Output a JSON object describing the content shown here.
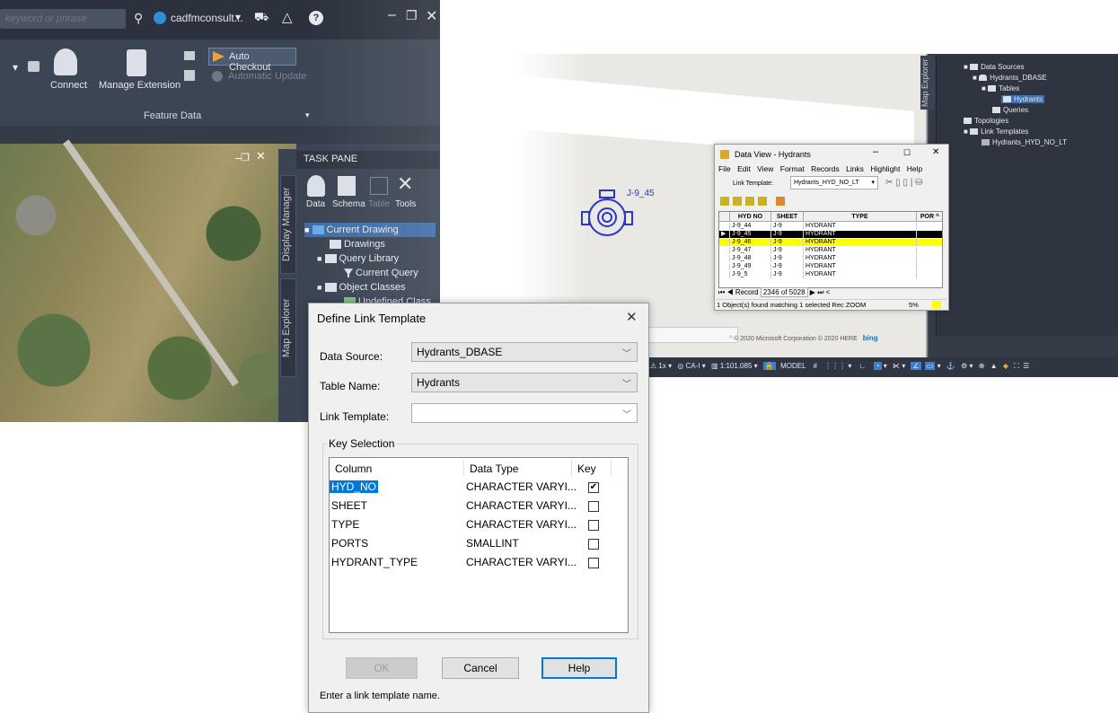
{
  "acad": {
    "search_placeholder": "keyword or phrase",
    "user": "cadfmconsult...",
    "ribbon": {
      "connect": "Connect",
      "manage_extension": "Manage Extension",
      "auto_checkout": "Auto Checkout",
      "automatic_update": "Automatic Update",
      "panel_title": "Feature Data"
    },
    "task_pane": {
      "title": "TASK PANE",
      "tabs": [
        "Display Manager",
        "Map Explorer"
      ],
      "tools": [
        "Data",
        "Schema",
        "Table",
        "Tools"
      ],
      "tree": [
        {
          "label": "Current Drawing",
          "level": 0
        },
        {
          "label": "Drawings",
          "level": 1
        },
        {
          "label": "Query Library",
          "level": 1
        },
        {
          "label": "Current Query",
          "level": 2
        },
        {
          "label": "Object Classes",
          "level": 1
        },
        {
          "label": "Undefined Class",
          "level": 2
        }
      ]
    }
  },
  "map": {
    "hydrant_label": "J-9_45",
    "copyright": "© 2020 Microsoft Corporation © 2020 HERE",
    "bing": "bing",
    "status_items": [
      "1x",
      "CA-I",
      "1:101.085",
      "MODEL"
    ],
    "explorer_tab": "Map Explorer",
    "explorer_tree": [
      {
        "label": "Data Sources",
        "level": 0
      },
      {
        "label": "Hydrants_DBASE",
        "level": 1
      },
      {
        "label": "Tables",
        "level": 2
      },
      {
        "label": "Hydrants",
        "level": 3
      },
      {
        "label": "Queries",
        "level": 2
      },
      {
        "label": "Topologies",
        "level": 0
      },
      {
        "label": "Link Templates",
        "level": 0
      },
      {
        "label": "Hydrants_HYD_NO_LT",
        "level": 1
      }
    ]
  },
  "data_view": {
    "title": "Data View - Hydrants",
    "menu": [
      "File",
      "Edit",
      "View",
      "Format",
      "Records",
      "Links",
      "Highlight",
      "Help"
    ],
    "link_template_label": "Link Template:",
    "link_template_value": "Hydrants_HYD_NO_LT",
    "columns": [
      "HYD NO",
      "SHEET",
      "TYPE",
      "POR"
    ],
    "rows": [
      [
        "J-9_44",
        "J-9",
        "HYDRANT"
      ],
      [
        "J-9_45",
        "J-9",
        "HYDRANT"
      ],
      [
        "J-9_46",
        "J-9",
        "HYDRANT"
      ],
      [
        "J-9_47",
        "J-9",
        "HYDRANT"
      ],
      [
        "J-9_48",
        "J-9",
        "HYDRANT"
      ],
      [
        "J-9_49",
        "J-9",
        "HYDRANT"
      ],
      [
        "J-9_5",
        "J-9",
        "HYDRANT"
      ]
    ],
    "record_label": "Record",
    "record_value": "2346 of 5028",
    "status": "1 Object(s) found matching 1 selected Rec ZOOM",
    "status_pct": "5%"
  },
  "dialog": {
    "title": "Define Link Template",
    "data_source_label": "Data Source:",
    "data_source_value": "Hydrants_DBASE",
    "table_name_label": "Table Name:",
    "table_name_value": "Hydrants",
    "link_template_label": "Link Template:",
    "link_template_value": "",
    "key_selection_label": "Key Selection",
    "headers": {
      "column": "Column",
      "data_type": "Data Type",
      "key": "Key"
    },
    "rows": [
      {
        "column": "HYD_NO",
        "data_type": "CHARACTER VARYI...",
        "key": true
      },
      {
        "column": "SHEET",
        "data_type": "CHARACTER VARYI...",
        "key": false
      },
      {
        "column": "TYPE",
        "data_type": "CHARACTER VARYI...",
        "key": false
      },
      {
        "column": "PORTS",
        "data_type": "SMALLINT",
        "key": false
      },
      {
        "column": "HYDRANT_TYPE",
        "data_type": "CHARACTER VARYI...",
        "key": false
      }
    ],
    "ok": "OK",
    "cancel": "Cancel",
    "help": "Help",
    "hint": "Enter a link template name."
  },
  "colors": {
    "selection": "#0078d7",
    "highlight_row": "#ffff00",
    "acad_dark": "#3b4453"
  }
}
